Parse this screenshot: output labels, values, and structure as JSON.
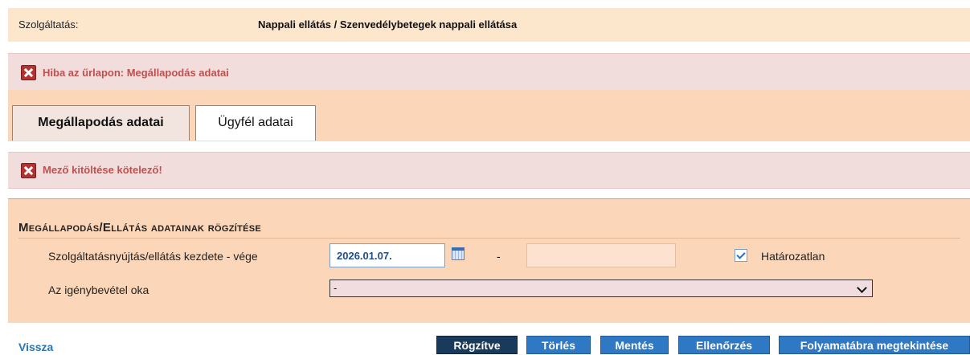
{
  "service": {
    "label": "Szolgáltatás:",
    "value": "Nappali ellátás / Szenvedélybetegek nappali ellátása"
  },
  "alerts": {
    "form_error": "Hiba az űrlapon: Megállapodás adatai",
    "field_error": "Mező kitöltése kötelező!"
  },
  "tabs": [
    {
      "label": "Megállapodás adatai",
      "active": true
    },
    {
      "label": "Ügyfél adatai",
      "active": false
    }
  ],
  "form": {
    "title": "Megállapodás/Ellátás adatainak rögzítése",
    "date_row": {
      "label": "Szolgáltatásnyújtás/ellátás kezdete - vége",
      "start_value": "2026.01.07.",
      "separator": "-",
      "end_value": "",
      "indefinite_label": "Határozatlan",
      "indefinite_checked": true
    },
    "reason_row": {
      "label": "Az igénybevétel oka",
      "selected": "-"
    }
  },
  "footer": {
    "back_link": "Vissza",
    "buttons": {
      "recorded": "Rögzítve",
      "delete": "Törlés",
      "save": "Mentés",
      "check": "Ellenőrzés",
      "flowchart": "Folyamatábra megtekintése"
    }
  },
  "colors": {
    "service_bar": "#fde7cc",
    "panel": "#fbd6b8",
    "alert_bg": "#f2dddd",
    "alert_text": "#c0504d",
    "button": "#2f78c4",
    "button_active": "#1a3a5c",
    "link": "#2a74b8"
  },
  "icons": [
    "error-icon",
    "calendar-icon",
    "checkmark-icon",
    "chevron-down-icon"
  ]
}
